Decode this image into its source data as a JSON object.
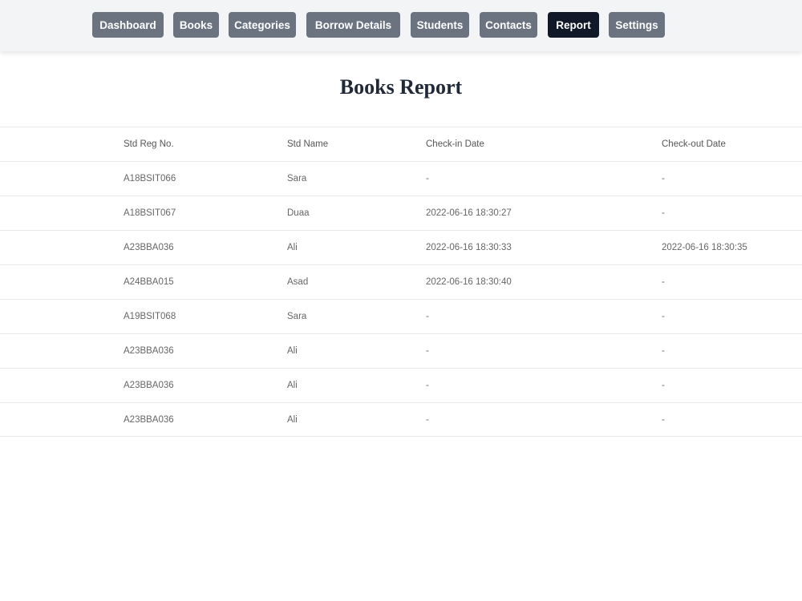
{
  "nav": {
    "items": [
      {
        "label": "Dashboard",
        "active": false
      },
      {
        "label": "Books",
        "active": false
      },
      {
        "label": "Categories",
        "active": false
      },
      {
        "label": "Borrow Details",
        "active": false
      },
      {
        "label": "Students",
        "active": false
      },
      {
        "label": "Contacts",
        "active": false
      },
      {
        "label": "Report",
        "active": true
      },
      {
        "label": "Settings",
        "active": false
      }
    ]
  },
  "page": {
    "title": "Books Report"
  },
  "table": {
    "headers": [
      "Std Reg No.",
      "Std Name",
      "Check-in Date",
      "Check-out Date"
    ],
    "rows": [
      [
        "A18BSIT066",
        "Sara",
        "-",
        "-"
      ],
      [
        "A18BSIT067",
        "Duaa",
        "2022-06-16 18:30:27",
        "-"
      ],
      [
        "A23BBA036",
        "Ali",
        "2022-06-16 18:30:33",
        "2022-06-16 18:30:35"
      ],
      [
        "A24BBA015",
        "Asad",
        "2022-06-16 18:30:40",
        "-"
      ],
      [
        "A19BSIT068",
        "Sara",
        "-",
        "-"
      ],
      [
        "A23BBA036",
        "Ali",
        "-",
        "-"
      ],
      [
        "A23BBA036",
        "Ali",
        "-",
        "-"
      ],
      [
        "A23BBA036",
        "Ali",
        "-",
        "-"
      ]
    ]
  },
  "colors": {
    "nav_bg": "#f3f4f6",
    "button": "#6b7280",
    "button_active": "#111827",
    "title": "#1f2937"
  }
}
